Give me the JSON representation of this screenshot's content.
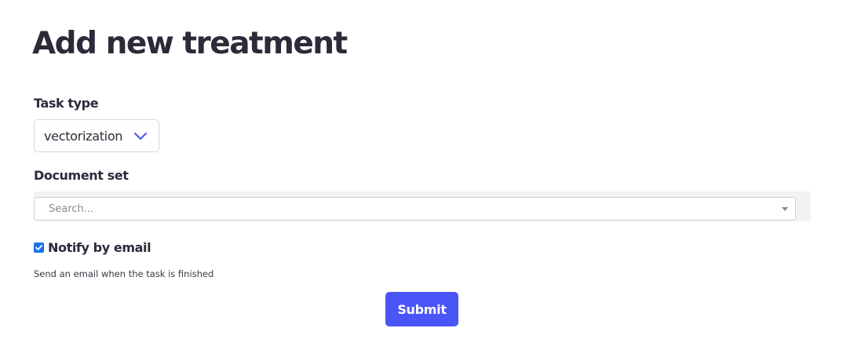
{
  "page": {
    "title": "Add new treatment"
  },
  "form": {
    "task_type": {
      "label": "Task type",
      "selected_value": "vectorization",
      "icon": "chevron-down-icon"
    },
    "document_set": {
      "label": "Document set",
      "placeholder": "Search...",
      "icon": "dropdown-caret-icon"
    },
    "notify": {
      "label": "Notify by email",
      "checked": true,
      "help_text": "Send an email when the task is finished"
    },
    "submit_label": "Submit"
  },
  "colors": {
    "accent": "#4a55f7",
    "checkbox": "#1a73e8",
    "text": "#2b2b3a",
    "chevron": "#4a55f7"
  }
}
